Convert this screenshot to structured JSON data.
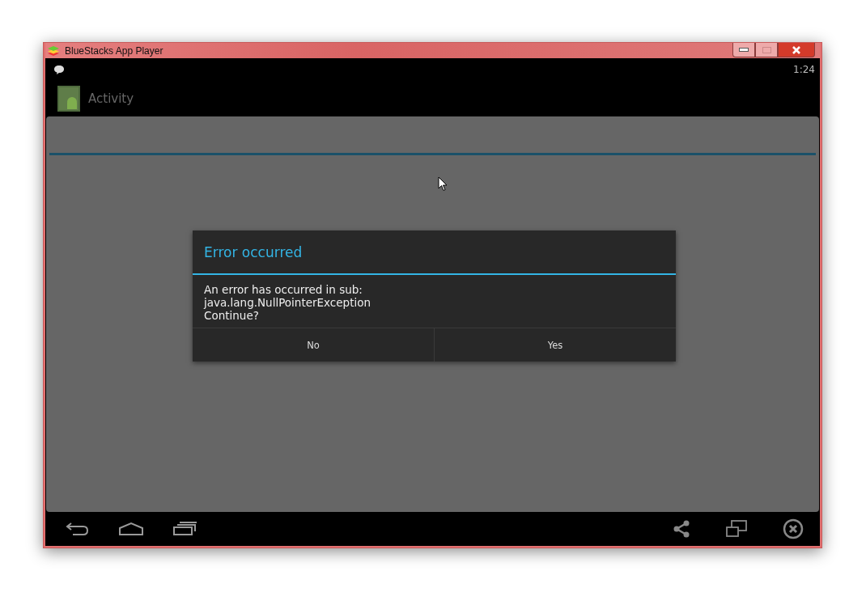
{
  "window": {
    "title": "BlueStacks App Player"
  },
  "status_bar": {
    "time": "1:24"
  },
  "action_bar": {
    "title": "Activity"
  },
  "dialog": {
    "title": "Error occurred",
    "message": [
      "An error has occurred in sub:",
      "java.lang.NullPointerException",
      "Continue?"
    ],
    "buttons": [
      {
        "label": "No"
      },
      {
        "label": "Yes"
      }
    ]
  }
}
